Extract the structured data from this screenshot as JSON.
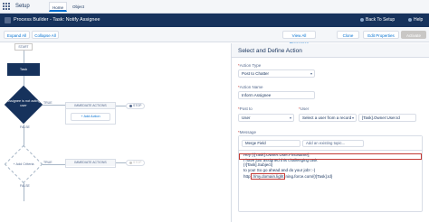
{
  "topbar": {
    "app_label": "Setup",
    "tabs": [
      {
        "label": "Home"
      },
      {
        "label": "Object Manager"
      }
    ]
  },
  "header": {
    "title": "Process Builder - Task: Notify Assignee",
    "back_label": "Back To Setup",
    "help_label": "Help"
  },
  "toolbar": {
    "expand_all": "Expand All",
    "collapse_all": "Collapse All",
    "view_all": "View All Processes",
    "clone": "Clone",
    "edit_properties": "Edit Properties",
    "activate": "Activate"
  },
  "canvas": {
    "start": "START",
    "object_node": "Task",
    "criteria_1": "Assignee is not acting user",
    "criteria_2": "+ Add Criteria",
    "true_label": "TRUE",
    "false_label": "FALSE",
    "immediate_actions": "IMMEDIATE ACTIONS",
    "add_action": "+ Add Action",
    "stop": "STOP"
  },
  "panel": {
    "title": "Select and Define Action",
    "action_type_label": "Action Type",
    "action_type_value": "Post to Chatter",
    "action_name_label": "Action Name",
    "action_name_value": "Inform Assignee",
    "post_to_label": "Post to",
    "post_to_value": "User",
    "user_label": "User",
    "user_select_value": "Select a user from a record",
    "user_field_value": "[Task].Owner:User.Id",
    "message_label": "Message",
    "merge_field": "Merge Field",
    "add_topic": "Add an existing topic...",
    "message_lines": [
      "Hey {![Task].Owner:User.FirstName},",
      "I have just assigned this challenging task",
      "{![Task].Subject}",
      "to you! So go ahead and do your job! :-)"
    ],
    "url_prefix": "http",
    "url_domain": "://my.domain.light",
    "url_suffix": "ning.force.com/{![Task].Id}"
  }
}
